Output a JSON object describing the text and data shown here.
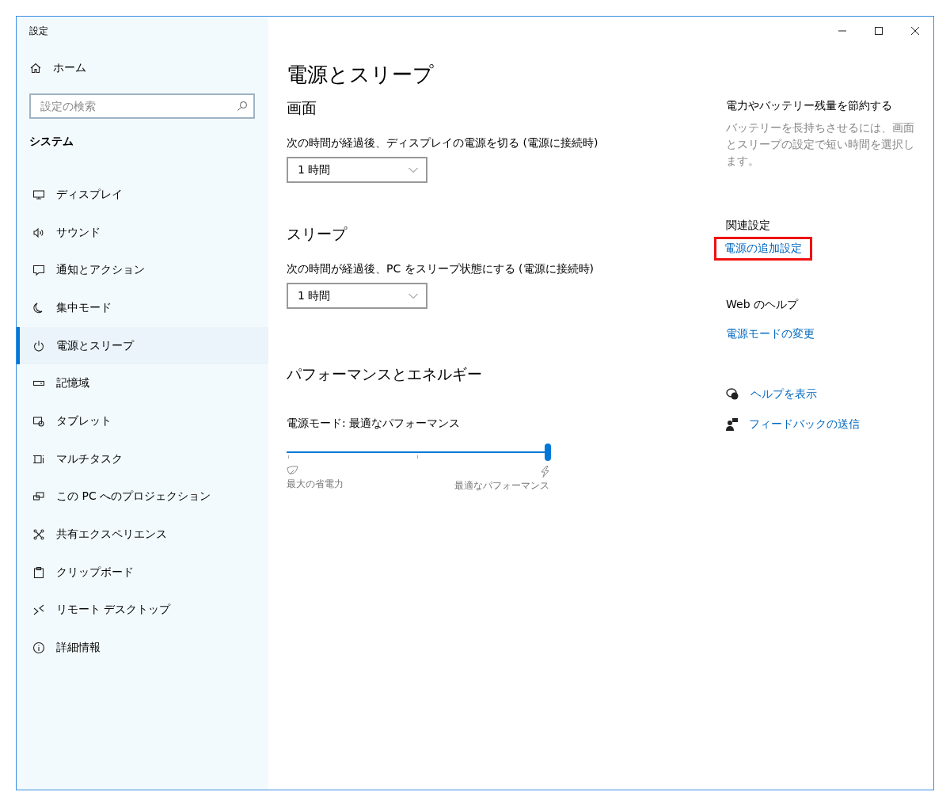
{
  "window": {
    "title": "設定"
  },
  "sidebar": {
    "home": "ホーム",
    "search": {
      "placeholder": "設定の検索"
    },
    "section": "システム",
    "items": [
      {
        "label": "ディスプレイ",
        "selected": false
      },
      {
        "label": "サウンド",
        "selected": false
      },
      {
        "label": "通知とアクション",
        "selected": false
      },
      {
        "label": "集中モード",
        "selected": false
      },
      {
        "label": "電源とスリープ",
        "selected": true
      },
      {
        "label": "記憶域",
        "selected": false
      },
      {
        "label": "タブレット",
        "selected": false
      },
      {
        "label": "マルチタスク",
        "selected": false
      },
      {
        "label": "この PC へのプロジェクション",
        "selected": false
      },
      {
        "label": "共有エクスペリエンス",
        "selected": false
      },
      {
        "label": "クリップボード",
        "selected": false
      },
      {
        "label": "リモート デスクトップ",
        "selected": false
      },
      {
        "label": "詳細情報",
        "selected": false
      }
    ]
  },
  "main": {
    "title": "電源とスリープ",
    "sections": [
      {
        "heading": "画面",
        "label": "次の時間が経過後、ディスプレイの電源を切る (電源に接続時)",
        "value": "1 時間"
      },
      {
        "heading": "スリープ",
        "label": "次の時間が経過後、PC をスリープ状態にする (電源に接続時)",
        "value": "1 時間"
      }
    ],
    "performance": {
      "heading": "パフォーマンスとエネルギー",
      "label": "電源モード: 最適なパフォーマンス",
      "level": 1,
      "min_label": "最大の省電力",
      "max_label": "最適なパフォーマンス"
    }
  },
  "aside": {
    "tip_heading": "電力やバッテリー残量を節約する",
    "tip_text": "バッテリーを長持ちさせるには、画面とスリープの設定で短い時間を選択します。",
    "related_heading": "関連設定",
    "related_link": {
      "label": "電源の追加設定",
      "highlighted": true
    },
    "help_heading": "Web のヘルプ",
    "help_link": "電源モードの変更",
    "actions": [
      "ヘルプを表示",
      "フィードバックの送信"
    ]
  }
}
